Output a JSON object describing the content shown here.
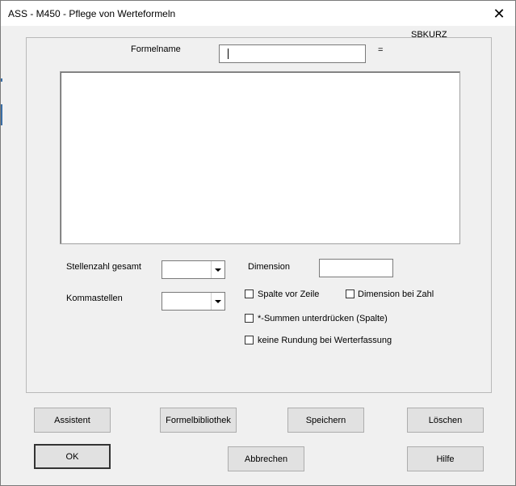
{
  "window": {
    "title": "ASS - M450 - Pflege von Werteformeln",
    "close_glyph": "✕"
  },
  "form": {
    "sbkurz_label": "SBKURZ",
    "formelname_label": "Formelname",
    "formelname_value": "",
    "equals_sign": "=",
    "formula_text": "",
    "stellenzahl_label": "Stellenzahl gesamt",
    "stellenzahl_value": "",
    "kommastellen_label": "Kommastellen",
    "kommastellen_value": "",
    "dimension_label": "Dimension",
    "dimension_value": ""
  },
  "checkboxes": [
    {
      "label": "Spalte vor Zeile",
      "checked": false
    },
    {
      "label": "Dimension bei Zahl",
      "checked": false
    },
    {
      "label": "*-Summen unterdrücken (Spalte)",
      "checked": false
    },
    {
      "label": "keine Rundung bei Werterfassung",
      "checked": false
    }
  ],
  "buttons": {
    "assistent": "Assistent",
    "formelbibliothek": "Formelbibliothek",
    "speichern": "Speichern",
    "loeschen": "Löschen",
    "ok": "OK",
    "abbrechen": "Abbrechen",
    "hilfe": "Hilfe"
  }
}
